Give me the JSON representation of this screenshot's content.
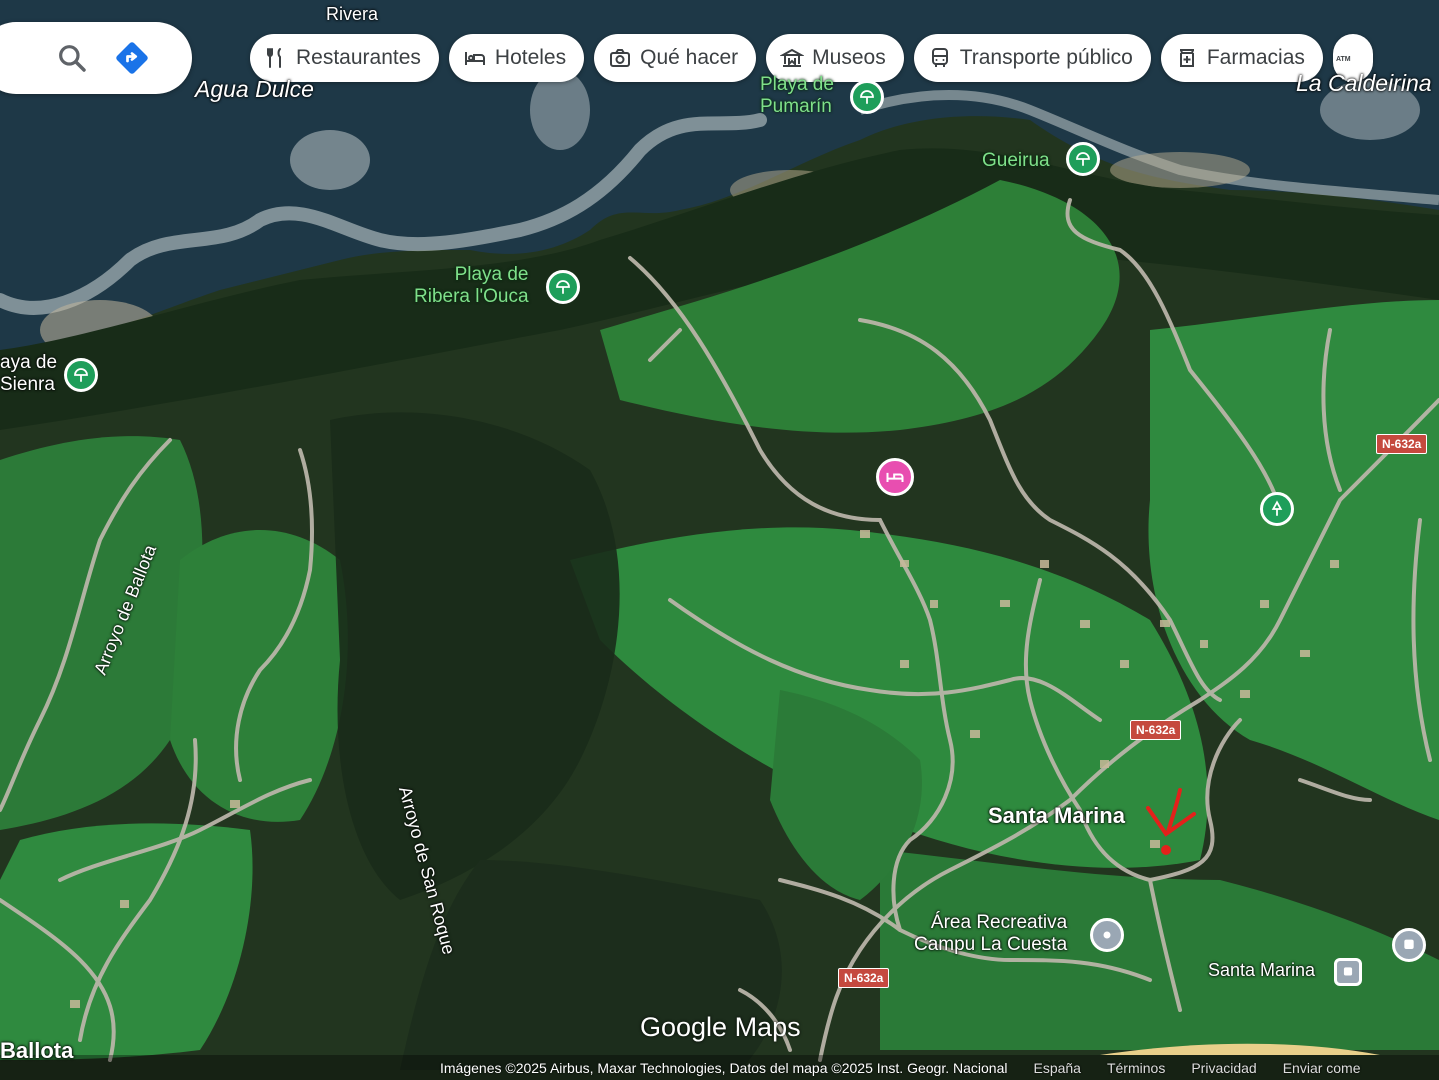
{
  "toolbar": {
    "chips": [
      {
        "label": "Restaurantes",
        "icon": "fork-knife-icon"
      },
      {
        "label": "Hoteles",
        "icon": "bed-icon"
      },
      {
        "label": "Qué hacer",
        "icon": "camera-icon"
      },
      {
        "label": "Museos",
        "icon": "museum-icon"
      },
      {
        "label": "Transporte público",
        "icon": "bus-icon"
      },
      {
        "label": "Farmacias",
        "icon": "pharmacy-icon"
      }
    ]
  },
  "labels": {
    "rivera": "Rivera",
    "agua_dulce": "Agua Dulce",
    "playa_pumarin_1": "Playa de",
    "playa_pumarin_2": "Pumarín",
    "la_caldeirina": "La Caldeirina",
    "gueirua": "Gueirua",
    "playa_ouca_1": "Playa de",
    "playa_ouca_2": "Ribera l'Ouca",
    "playa_sienra_1": "aya de",
    "playa_sienra_2": "Sienra",
    "arroyo_ballota": "Arroyo de Ballota",
    "arroyo_san_roque": "Arroyo de San Roque",
    "santa_marina": "Santa Marina",
    "area_rec_1": "Área Recreativa",
    "area_rec_2": "Campu La Cuesta",
    "santa_marina_bus": "Santa Marina",
    "ballota": "Ballota"
  },
  "roads": {
    "n632a": "N-632a"
  },
  "footer": {
    "watermark": "Google Maps",
    "attribution": "Imágenes ©2025 Airbus, Maxar Technologies, Datos del mapa ©2025 Inst. Geogr. Nacional",
    "country": "España",
    "terms": "Términos",
    "privacy": "Privacidad",
    "feedback": "Enviar come"
  },
  "colors": {
    "sea": "#1f3a47",
    "forest": "#1f3320",
    "meadow": "#2f8a3f",
    "road": "#b9b3a8",
    "beach_pin": "#1e9e5a",
    "hotel_pin": "#e84eb0",
    "marker": "#e3211b"
  }
}
